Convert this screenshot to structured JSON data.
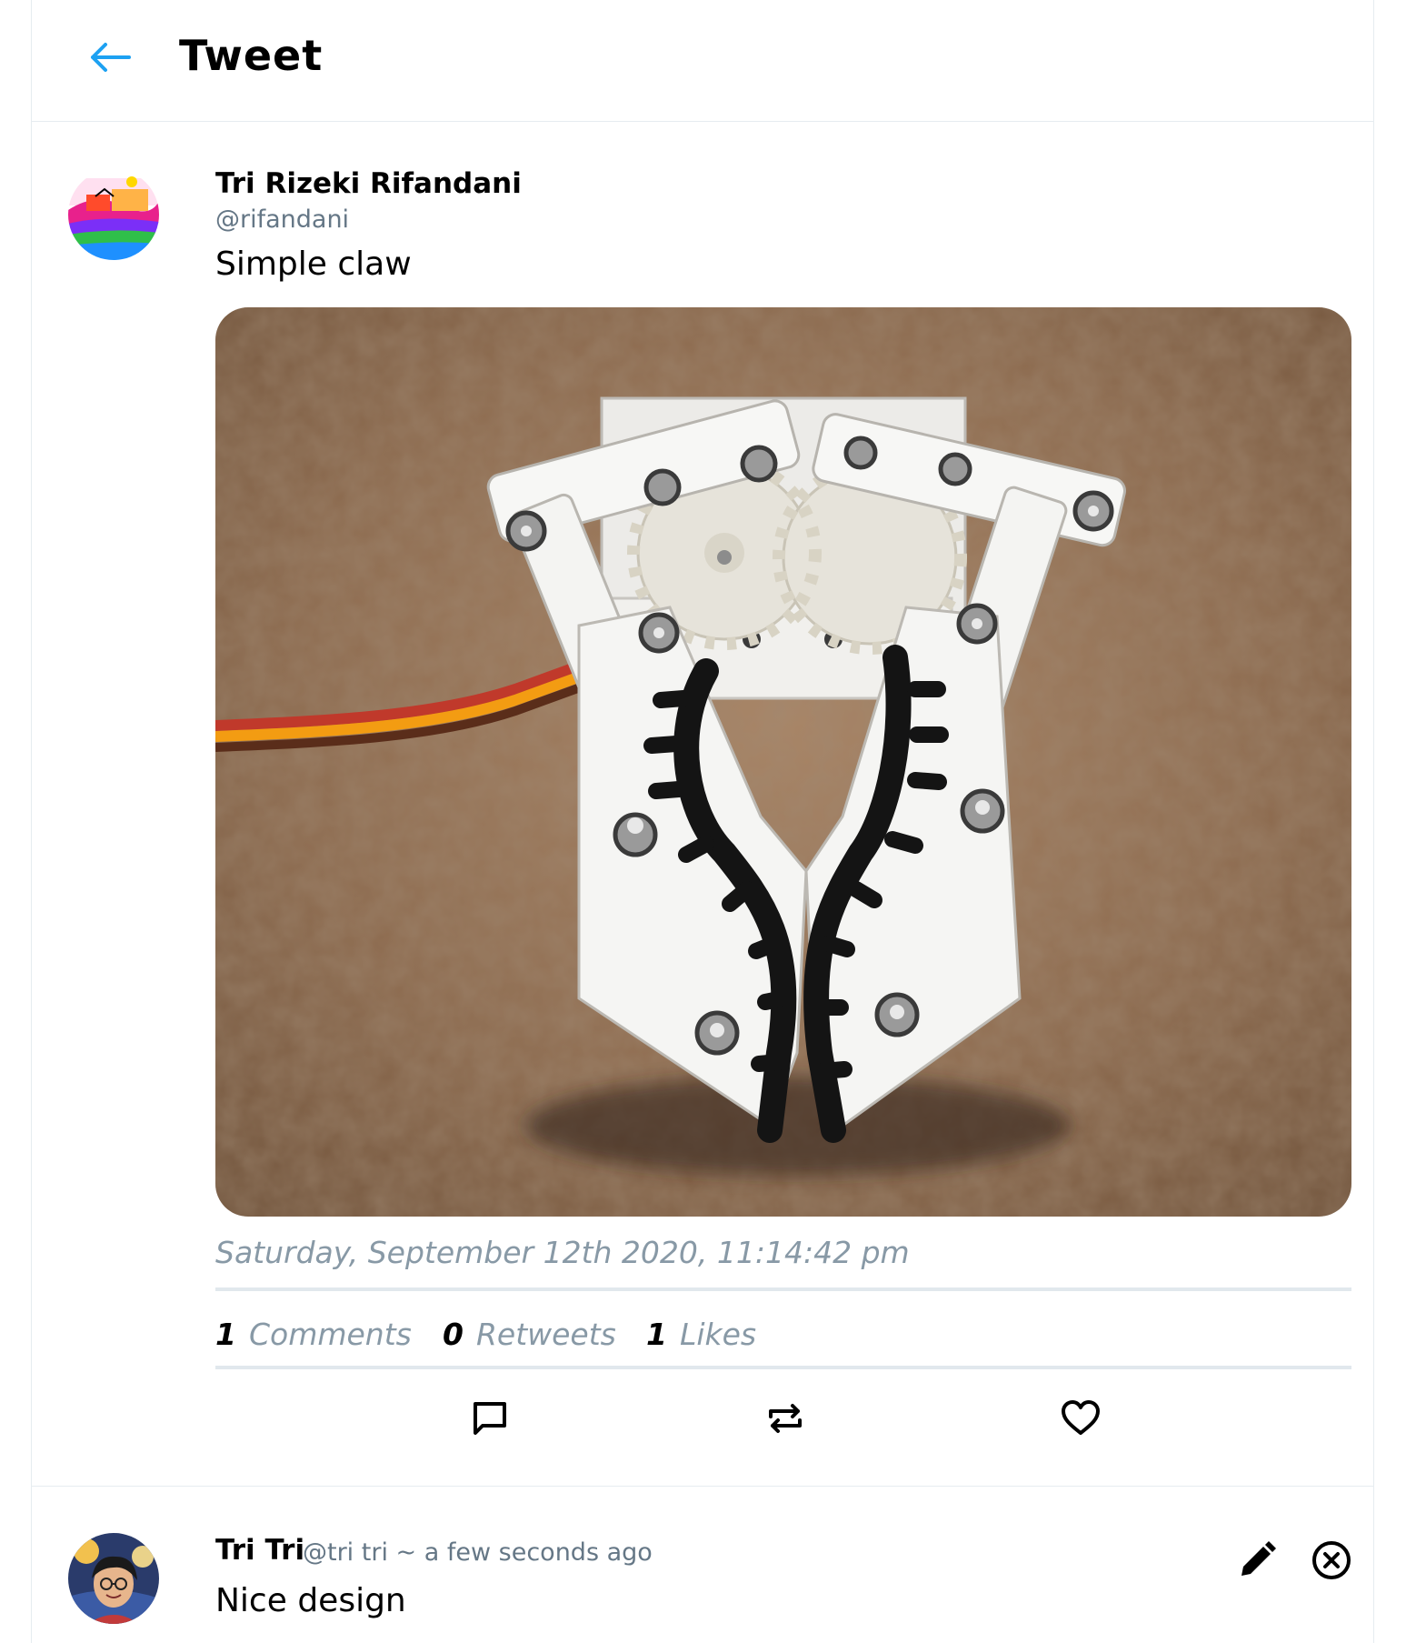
{
  "header": {
    "title": "Tweet",
    "back_icon": "arrow-left-icon",
    "accent_color": "#1da1f2"
  },
  "tweet": {
    "author_name": "Tri Rizeki Rifandani",
    "author_handle": "@rifandani",
    "text": "Simple claw",
    "media_icon": "robot-claw-photo",
    "timestamp": "Saturday, September 12th 2020, 11:14:42 pm",
    "stats": {
      "comments_count": "1",
      "comments_label": "Comments",
      "retweets_count": "0",
      "retweets_label": "Retweets",
      "likes_count": "1",
      "likes_label": "Likes"
    },
    "actions": {
      "comment_icon": "comment-icon",
      "retweet_icon": "retweet-icon",
      "like_icon": "heart-icon"
    }
  },
  "reply": {
    "author_name": "Tri Tri",
    "meta": "@tri tri ~ a few seconds ago",
    "text": "Nice design",
    "edit_icon": "pencil-icon",
    "delete_icon": "close-circle-icon"
  }
}
